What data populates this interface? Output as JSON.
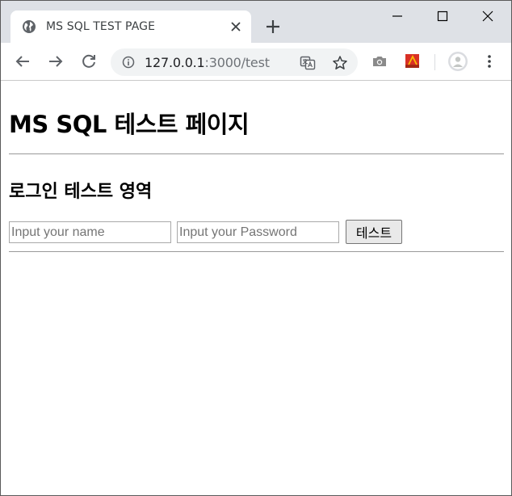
{
  "browser": {
    "tab": {
      "title": "MS SQL TEST PAGE"
    },
    "address": {
      "host": "127.0.0.1",
      "path": ":3000/test"
    }
  },
  "page": {
    "title": "MS SQL 테스트 페이지",
    "section_title": "로그인 테스트 영역",
    "name_input": {
      "placeholder": "Input your name",
      "value": ""
    },
    "password_input": {
      "placeholder": "Input your Password",
      "value": ""
    },
    "submit_label": "테스트"
  },
  "colors": {
    "tabstrip": "#dee1e6",
    "omnibox": "#f1f3f4",
    "ext_red": "#d93025"
  },
  "icons": [
    "globe-icon",
    "close-icon",
    "plus-icon",
    "minimize-icon",
    "maximize-icon",
    "window-close-icon",
    "back-arrow-icon",
    "forward-arrow-icon",
    "reload-icon",
    "info-icon",
    "translate-icon",
    "star-icon",
    "camera-icon",
    "extension-icon",
    "profile-icon",
    "menu-dots-icon"
  ]
}
